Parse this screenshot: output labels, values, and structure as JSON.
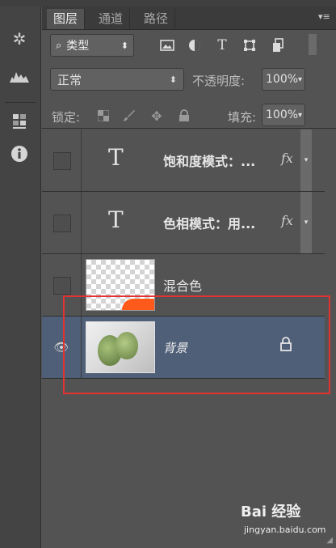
{
  "panel": {
    "tabs": [
      {
        "label": "图层",
        "active": true
      },
      {
        "label": "通道",
        "active": false
      },
      {
        "label": "路径",
        "active": false
      }
    ]
  },
  "filter": {
    "kind_icon": "search-icon",
    "kind_label": "类型",
    "icons": [
      "image-filter-icon",
      "adjustment-filter-icon",
      "type-filter-icon",
      "shape-filter-icon",
      "smart-object-filter-icon"
    ]
  },
  "blend": {
    "mode": "正常",
    "opacity_label": "不透明度:",
    "opacity_value": "100%"
  },
  "lock": {
    "label": "锁定:",
    "fill_label": "填充:",
    "fill_value": "100%"
  },
  "layers": [
    {
      "name": "饱和度模式：...",
      "type": "text",
      "visible": false,
      "fx": "fx"
    },
    {
      "name": "色相模式：用...",
      "type": "text",
      "visible": false,
      "fx": "fx"
    },
    {
      "name": "混合色",
      "type": "image",
      "visible": false
    },
    {
      "name": "背景",
      "type": "background",
      "visible": true,
      "locked": true,
      "selected": true
    }
  ],
  "watermark": {
    "brand": "Bai 经验",
    "url": "jingyan.baidu.com"
  },
  "colors": {
    "selection": "#4f5f77",
    "highlight_box": "#e23232",
    "accent_orange": "#ff5a1a"
  }
}
